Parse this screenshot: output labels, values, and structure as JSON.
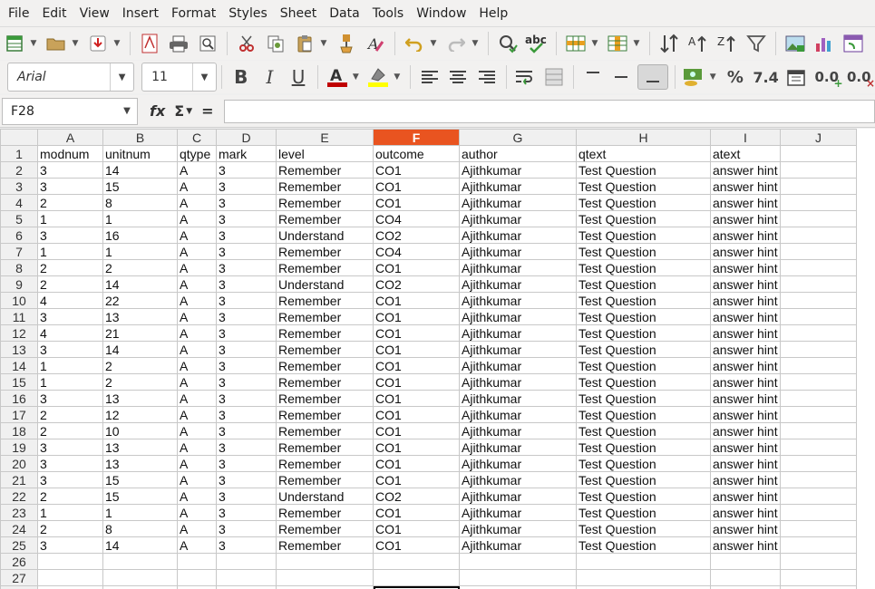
{
  "menu": [
    "File",
    "Edit",
    "View",
    "Insert",
    "Format",
    "Styles",
    "Sheet",
    "Data",
    "Tools",
    "Window",
    "Help"
  ],
  "font": {
    "name": "Arial",
    "size": "11"
  },
  "namebox": "F28",
  "formula_buttons": {
    "fx": "fx",
    "sigma": "Σ",
    "equals": "="
  },
  "format_labels": {
    "bold": "B",
    "italic": "I",
    "underline": "U",
    "percent": "%",
    "number": "7.4",
    "add_decimal": "0.0",
    "del_decimal": "0.0"
  },
  "columns": [
    "A",
    "B",
    "C",
    "D",
    "E",
    "F",
    "G",
    "H",
    "I",
    "J"
  ],
  "selected_column": "F",
  "headers": [
    "modnum",
    "unitnum",
    "qtype",
    "mark",
    "level",
    "outcome",
    "author",
    "qtext",
    "atext"
  ],
  "rows": [
    [
      "3",
      "14",
      "A",
      "3",
      "Remember",
      "CO1",
      "Ajithkumar",
      "Test Question",
      "answer hint"
    ],
    [
      "3",
      "15",
      "A",
      "3",
      "Remember",
      "CO1",
      "Ajithkumar",
      "Test Question",
      "answer hint"
    ],
    [
      "2",
      "8",
      "A",
      "3",
      "Remember",
      "CO1",
      "Ajithkumar",
      "Test Question",
      "answer hint"
    ],
    [
      "1",
      "1",
      "A",
      "3",
      "Remember",
      "CO4",
      "Ajithkumar",
      "Test Question",
      "answer hint"
    ],
    [
      "3",
      "16",
      "A",
      "3",
      "Understand",
      "CO2",
      "Ajithkumar",
      "Test Question",
      "answer hint"
    ],
    [
      "1",
      "1",
      "A",
      "3",
      "Remember",
      "CO4",
      "Ajithkumar",
      "Test Question",
      "answer hint"
    ],
    [
      "2",
      "2",
      "A",
      "3",
      "Remember",
      "CO1",
      "Ajithkumar",
      "Test Question",
      "answer hint"
    ],
    [
      "2",
      "14",
      "A",
      "3",
      "Understand",
      "CO2",
      "Ajithkumar",
      "Test Question",
      "answer hint"
    ],
    [
      "4",
      "22",
      "A",
      "3",
      "Remember",
      "CO1",
      "Ajithkumar",
      "Test Question",
      "answer hint"
    ],
    [
      "3",
      "13",
      "A",
      "3",
      "Remember",
      "CO1",
      "Ajithkumar",
      "Test Question",
      "answer hint"
    ],
    [
      "4",
      "21",
      "A",
      "3",
      "Remember",
      "CO1",
      "Ajithkumar",
      "Test Question",
      "answer hint"
    ],
    [
      "3",
      "14",
      "A",
      "3",
      "Remember",
      "CO1",
      "Ajithkumar",
      "Test Question",
      "answer hint"
    ],
    [
      "1",
      "2",
      "A",
      "3",
      "Remember",
      "CO1",
      "Ajithkumar",
      "Test Question",
      "answer hint"
    ],
    [
      "1",
      "2",
      "A",
      "3",
      "Remember",
      "CO1",
      "Ajithkumar",
      "Test Question",
      "answer hint"
    ],
    [
      "3",
      "13",
      "A",
      "3",
      "Remember",
      "CO1",
      "Ajithkumar",
      "Test Question",
      "answer hint"
    ],
    [
      "2",
      "12",
      "A",
      "3",
      "Remember",
      "CO1",
      "Ajithkumar",
      "Test Question",
      "answer hint"
    ],
    [
      "2",
      "10",
      "A",
      "3",
      "Remember",
      "CO1",
      "Ajithkumar",
      "Test Question",
      "answer hint"
    ],
    [
      "3",
      "13",
      "A",
      "3",
      "Remember",
      "CO1",
      "Ajithkumar",
      "Test Question",
      "answer hint"
    ],
    [
      "3",
      "13",
      "A",
      "3",
      "Remember",
      "CO1",
      "Ajithkumar",
      "Test Question",
      "answer hint"
    ],
    [
      "3",
      "15",
      "A",
      "3",
      "Remember",
      "CO1",
      "Ajithkumar",
      "Test Question",
      "answer hint"
    ],
    [
      "2",
      "15",
      "A",
      "3",
      "Understand",
      "CO2",
      "Ajithkumar",
      "Test Question",
      "answer hint"
    ],
    [
      "1",
      "1",
      "A",
      "3",
      "Remember",
      "CO1",
      "Ajithkumar",
      "Test Question",
      "answer hint"
    ],
    [
      "2",
      "8",
      "A",
      "3",
      "Remember",
      "CO1",
      "Ajithkumar",
      "Test Question",
      "answer hint"
    ],
    [
      "3",
      "14",
      "A",
      "3",
      "Remember",
      "CO1",
      "Ajithkumar",
      "Test Question",
      "answer hint"
    ]
  ],
  "empty_rows": [
    "26",
    "27"
  ],
  "colors": {
    "selected_header": "#e95420",
    "font_color": "#c00000",
    "highlight": "#ffff00"
  }
}
